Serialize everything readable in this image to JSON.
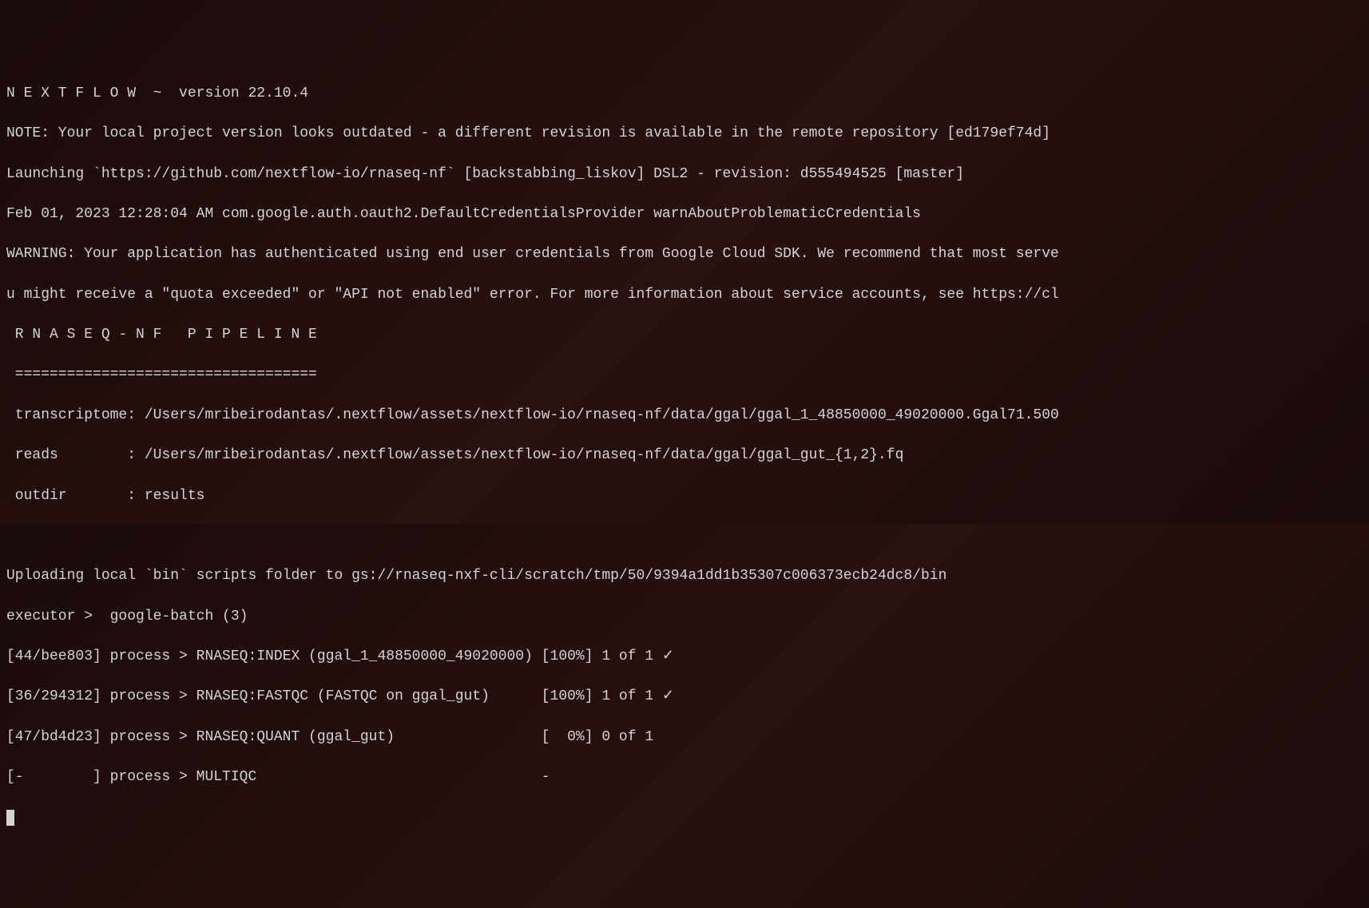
{
  "header": {
    "nextflow_banner": "N E X T F L O W  ~  version 22.10.4"
  },
  "messages": {
    "note": "NOTE: Your local project version looks outdated - a different revision is available in the remote repository [ed179ef74d]",
    "launching": "Launching `https://github.com/nextflow-io/rnaseq-nf` [backstabbing_liskov] DSL2 - revision: d555494525 [master]",
    "timestamp_line": "Feb 01, 2023 12:28:04 AM com.google.auth.oauth2.DefaultCredentialsProvider warnAboutProblematicCredentials",
    "warning_line1": "WARNING: Your application has authenticated using end user credentials from Google Cloud SDK. We recommend that most serve",
    "warning_line2": "u might receive a \"quota exceeded\" or \"API not enabled\" error. For more information about service accounts, see https://cl"
  },
  "pipeline": {
    "title": " R N A S E Q - N F   P I P E L I N E",
    "separator": " ===================================",
    "transcriptome_line": " transcriptome: /Users/mribeirodantas/.nextflow/assets/nextflow-io/rnaseq-nf/data/ggal/ggal_1_48850000_49020000.Ggal71.500",
    "reads_line": " reads        : /Users/mribeirodantas/.nextflow/assets/nextflow-io/rnaseq-nf/data/ggal/ggal_gut_{1,2}.fq",
    "outdir_line": " outdir       : results"
  },
  "execution": {
    "uploading": "Uploading local `bin` scripts folder to gs://rnaseq-nxf-cli/scratch/tmp/50/9394a1dd1b35307c006373ecb24dc8/bin",
    "executor": "executor >  google-batch (3)"
  },
  "processes": [
    {
      "line": "[44/bee803] process > RNASEQ:INDEX (ggal_1_48850000_49020000) [100%] 1 of 1 ✓"
    },
    {
      "line": "[36/294312] process > RNASEQ:FASTQC (FASTQC on ggal_gut)      [100%] 1 of 1 ✓"
    },
    {
      "line": "[47/bd4d23] process > RNASEQ:QUANT (ggal_gut)                 [  0%] 0 of 1"
    },
    {
      "line": "[-        ] process > MULTIQC                                 -"
    }
  ]
}
